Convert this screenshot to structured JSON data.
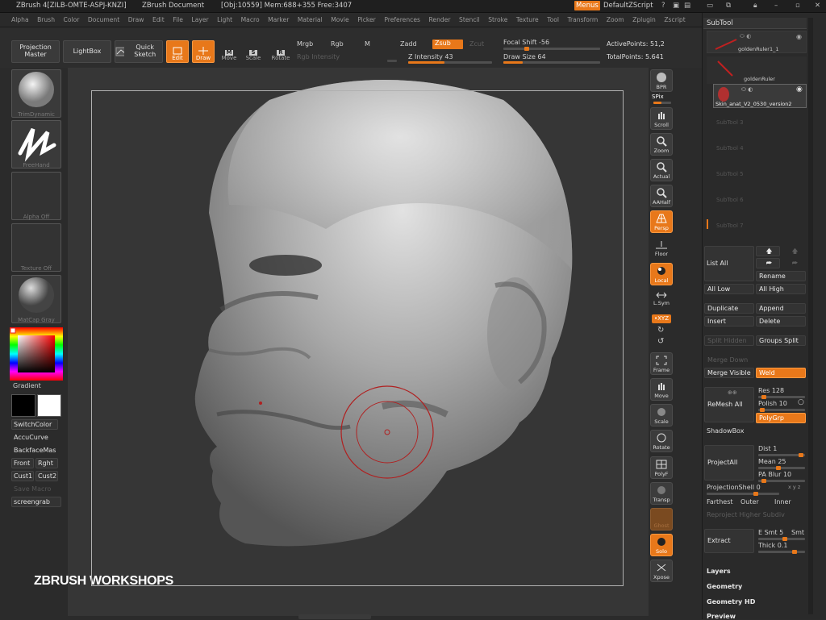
{
  "titlebar": {
    "app": "ZBrush 4[ZILB-OMTE-ASPJ-KNZI]",
    "doc": "ZBrush Document",
    "stats": "[Obj:10559] Mem:688+355 Free:3407",
    "menus_btn": "Menus",
    "script": "DefaultZScript"
  },
  "menubar": [
    "Alpha",
    "Brush",
    "Color",
    "Document",
    "Draw",
    "Edit",
    "File",
    "Layer",
    "Light",
    "Macro",
    "Marker",
    "Material",
    "Movie",
    "Picker",
    "Preferences",
    "Render",
    "Stencil",
    "Stroke",
    "Texture",
    "Tool",
    "Transform",
    "Zoom",
    "Zplugin",
    "Zscript"
  ],
  "toolbar": {
    "projection_master": "Projection Master",
    "lightbox": "LightBox",
    "quick_sketch": "Quick Sketch",
    "edit": "Edit",
    "draw": "Draw",
    "move": "Move",
    "scale": "Scale",
    "rotate": "Rotate",
    "mrgb": "Mrgb",
    "rgb": "Rgb",
    "m": "M",
    "rgb_intensity": "Rgb Intensity",
    "zadd": "Zadd",
    "zsub": "Zsub",
    "zcut": "Zcut",
    "z_intensity": "Z Intensity 43",
    "z_intensity_value": 0.43,
    "focal_shift": "Focal Shift -56",
    "focal_shift_value": -0.56,
    "draw_size": "Draw Size 64",
    "draw_size_value": 0.2,
    "active_points": "ActivePoints: 51,2",
    "total_points": "TotalPoints: 5.641"
  },
  "leftshelf": {
    "brush": "TrimDynamic",
    "stroke": "FreeHand",
    "alpha": "Alpha Off",
    "texture": "Texture Off",
    "material": "MatCap Gray",
    "gradient": "Gradient",
    "switch_color": "SwitchColor",
    "accucurve": "AccuCurve",
    "backface": "BackfaceMas",
    "front": "Front",
    "right": "Rght",
    "cust1": "Cust1",
    "cust2": "Cust2",
    "save_macro": "Save Macro",
    "screengrab": "screengrab"
  },
  "rightshelf": {
    "bpr": "BPR",
    "spix": "SPix",
    "scroll": "Scroll",
    "zoom": "Zoom",
    "actual": "Actual",
    "aahalf": "AAHalf",
    "persp": "Persp",
    "floor": "Floor",
    "local": "Local",
    "lsym": "L.Sym",
    "xyz": "•XYZ",
    "frame": "Frame",
    "move": "Move",
    "scale": "Scale",
    "rotate": "Rotate",
    "polyf": "PolyF",
    "transp": "Transp",
    "ghost": "Ghost",
    "solo": "Solo",
    "xpose": "Xpose"
  },
  "watermark": "ZBRUSH WORKSHOPS",
  "subtool": {
    "title": "SubTool",
    "items": [
      "goldenRuler1_1",
      "goldenRuler",
      "Skin_anat_V2_0530_version2"
    ],
    "empty": [
      "SubTool 3",
      "SubTool 4",
      "SubTool 5",
      "SubTool 6",
      "SubTool 7"
    ],
    "list_all": "List All",
    "rename": "Rename",
    "all_low": "All Low",
    "all_high": "All High",
    "duplicate": "Duplicate",
    "append": "Append",
    "insert": "Insert",
    "delete": "Delete",
    "split_hidden": "Split Hidden",
    "groups_split": "Groups Split",
    "merge_down": "Merge Down",
    "merge_visible": "Merge Visible",
    "weld": "Weld",
    "remesh_all": "ReMesh All",
    "res": "Res 128",
    "polish": "Polish 10",
    "polygrp": "PolyGrp",
    "shadowbox": "ShadowBox",
    "project_all": "ProjectAll",
    "dist": "Dist 1",
    "mean": "Mean 25",
    "pa_blur": "PA Blur 10",
    "projection_shell": "ProjectionShell 0",
    "xyz_icon": "x y z",
    "farthest": "Farthest",
    "outer": "Outer",
    "inner": "Inner",
    "reproject": "Reproject Higher Subdiv",
    "extract": "Extract",
    "esmt": "E Smt 5",
    "smt": "Smt",
    "thick": "Thick 0.1",
    "layers": "Layers",
    "geometry": "Geometry",
    "geometry_hd": "Geometry HD",
    "preview": "Preview"
  }
}
